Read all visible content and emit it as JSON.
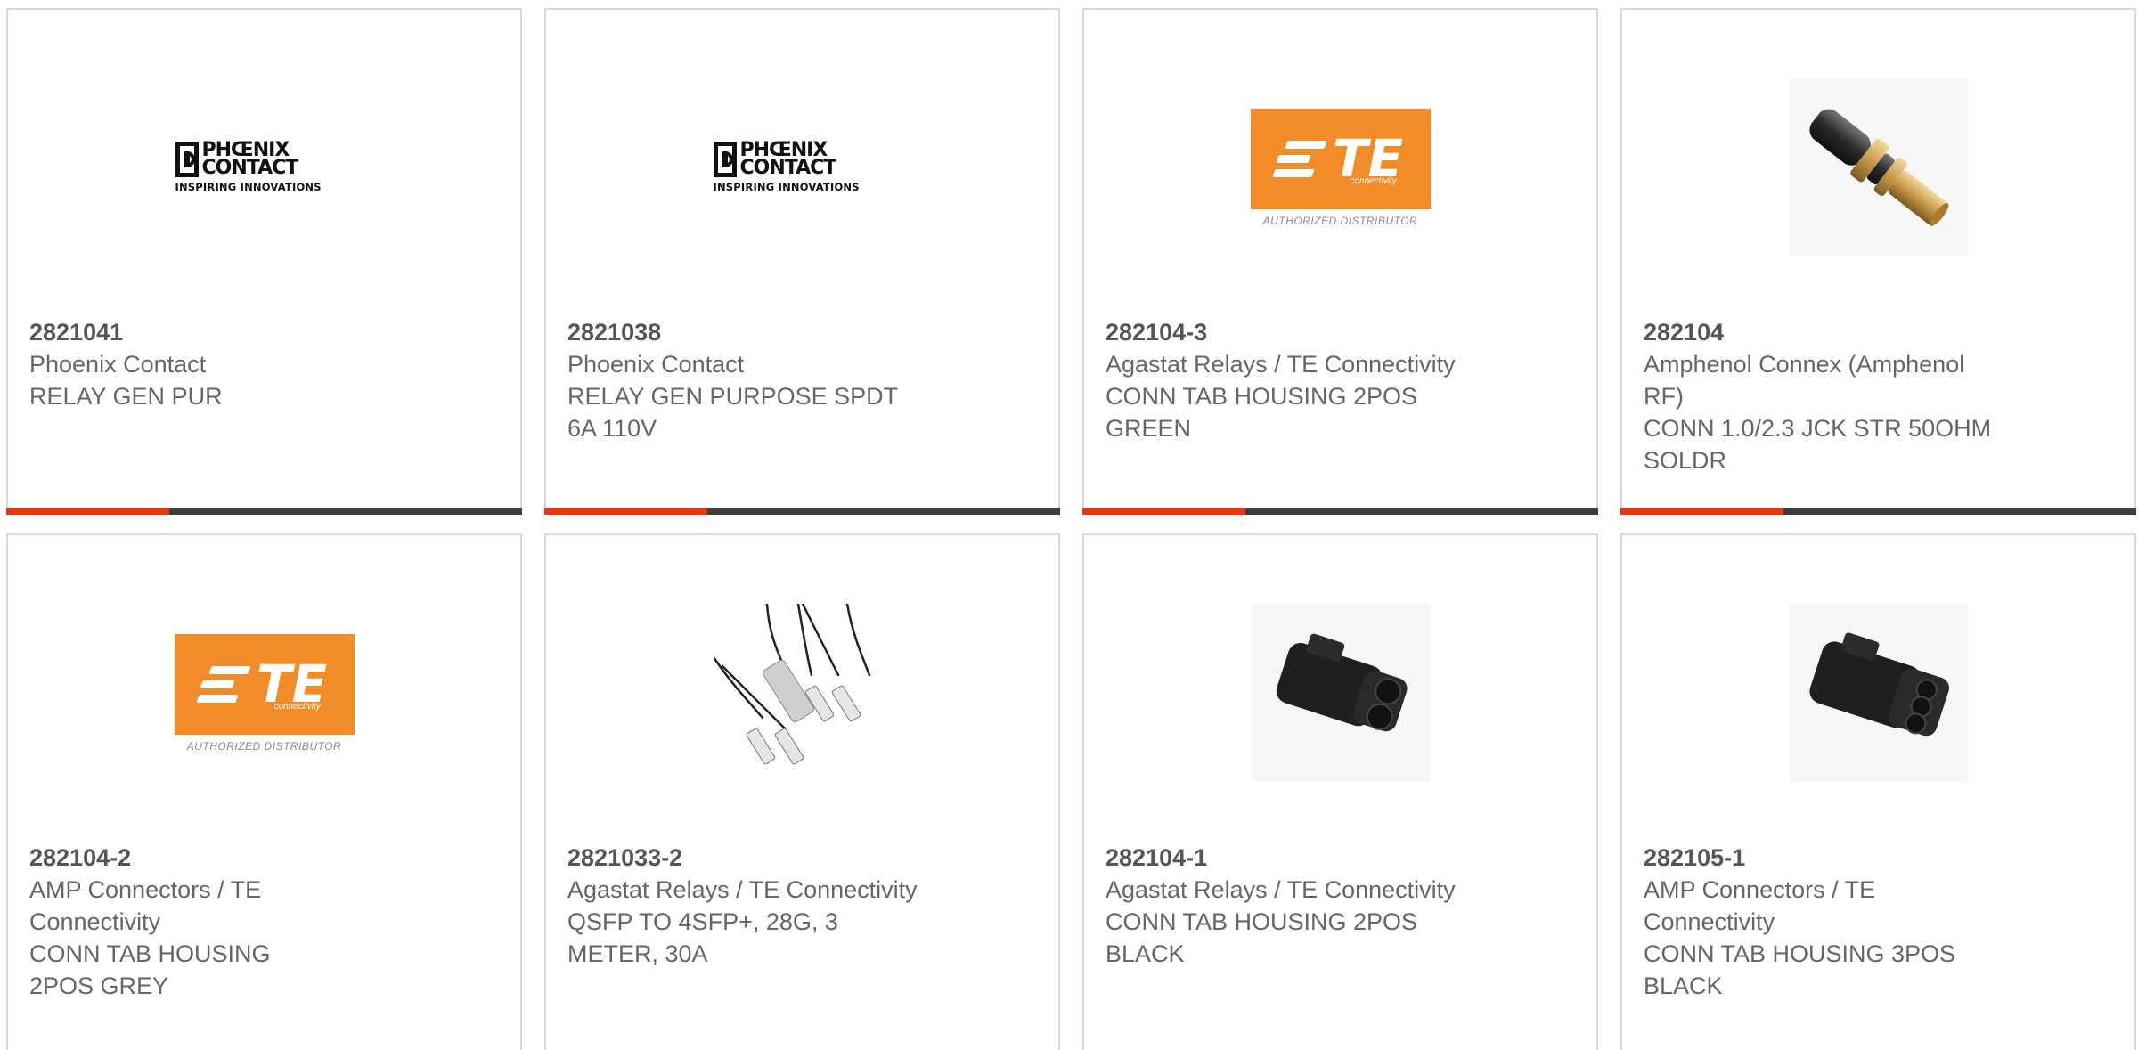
{
  "logos": {
    "phoenix_name": "PHŒNIX CONTACT",
    "phoenix_tagline": "INSPIRING INNOVATIONS",
    "te_name": "TE",
    "te_connectivity": "connectivity",
    "te_authorized": "AUTHORIZED DISTRIBUTOR"
  },
  "colors": {
    "accent_bar": "#e8380d",
    "bar_dark": "#3d3d3d",
    "te_orange": "#f28c28"
  },
  "cards": [
    {
      "image": "phoenix-contact-logo",
      "part_number": "2821041",
      "manufacturer": "Phoenix Contact",
      "description": "RELAY GEN PUR"
    },
    {
      "image": "phoenix-contact-logo",
      "part_number": "2821038",
      "manufacturer": "Phoenix Contact",
      "description": "RELAY GEN PURPOSE SPDT 6A 110V"
    },
    {
      "image": "te-connectivity-logo",
      "part_number": "282104-3",
      "manufacturer": "Agastat Relays / TE Connectivity",
      "description": "CONN TAB HOUSING 2POS GREEN"
    },
    {
      "image": "rf-connector-photo",
      "part_number": "282104",
      "manufacturer": "Amphenol Connex (Amphenol RF)",
      "description": "CONN 1.0/2.3 JCK STR 50OHM SOLDR"
    },
    {
      "image": "te-connectivity-logo",
      "part_number": "282104-2",
      "manufacturer": "AMP Connectors / TE Connectivity",
      "description": "CONN TAB HOUSING 2POS GREY"
    },
    {
      "image": "qsfp-cable-photo",
      "part_number": "2821033-2",
      "manufacturer": "Agastat Relays / TE Connectivity",
      "description": "QSFP TO 4SFP+, 28G, 3 METER, 30A"
    },
    {
      "image": "2pos-housing-photo",
      "part_number": "282104-1",
      "manufacturer": "Agastat Relays / TE Connectivity",
      "description": "CONN TAB HOUSING 2POS BLACK"
    },
    {
      "image": "3pos-housing-photo",
      "part_number": "282105-1",
      "manufacturer": "AMP Connectors / TE Connectivity",
      "description": "CONN TAB HOUSING 3POS BLACK"
    }
  ]
}
